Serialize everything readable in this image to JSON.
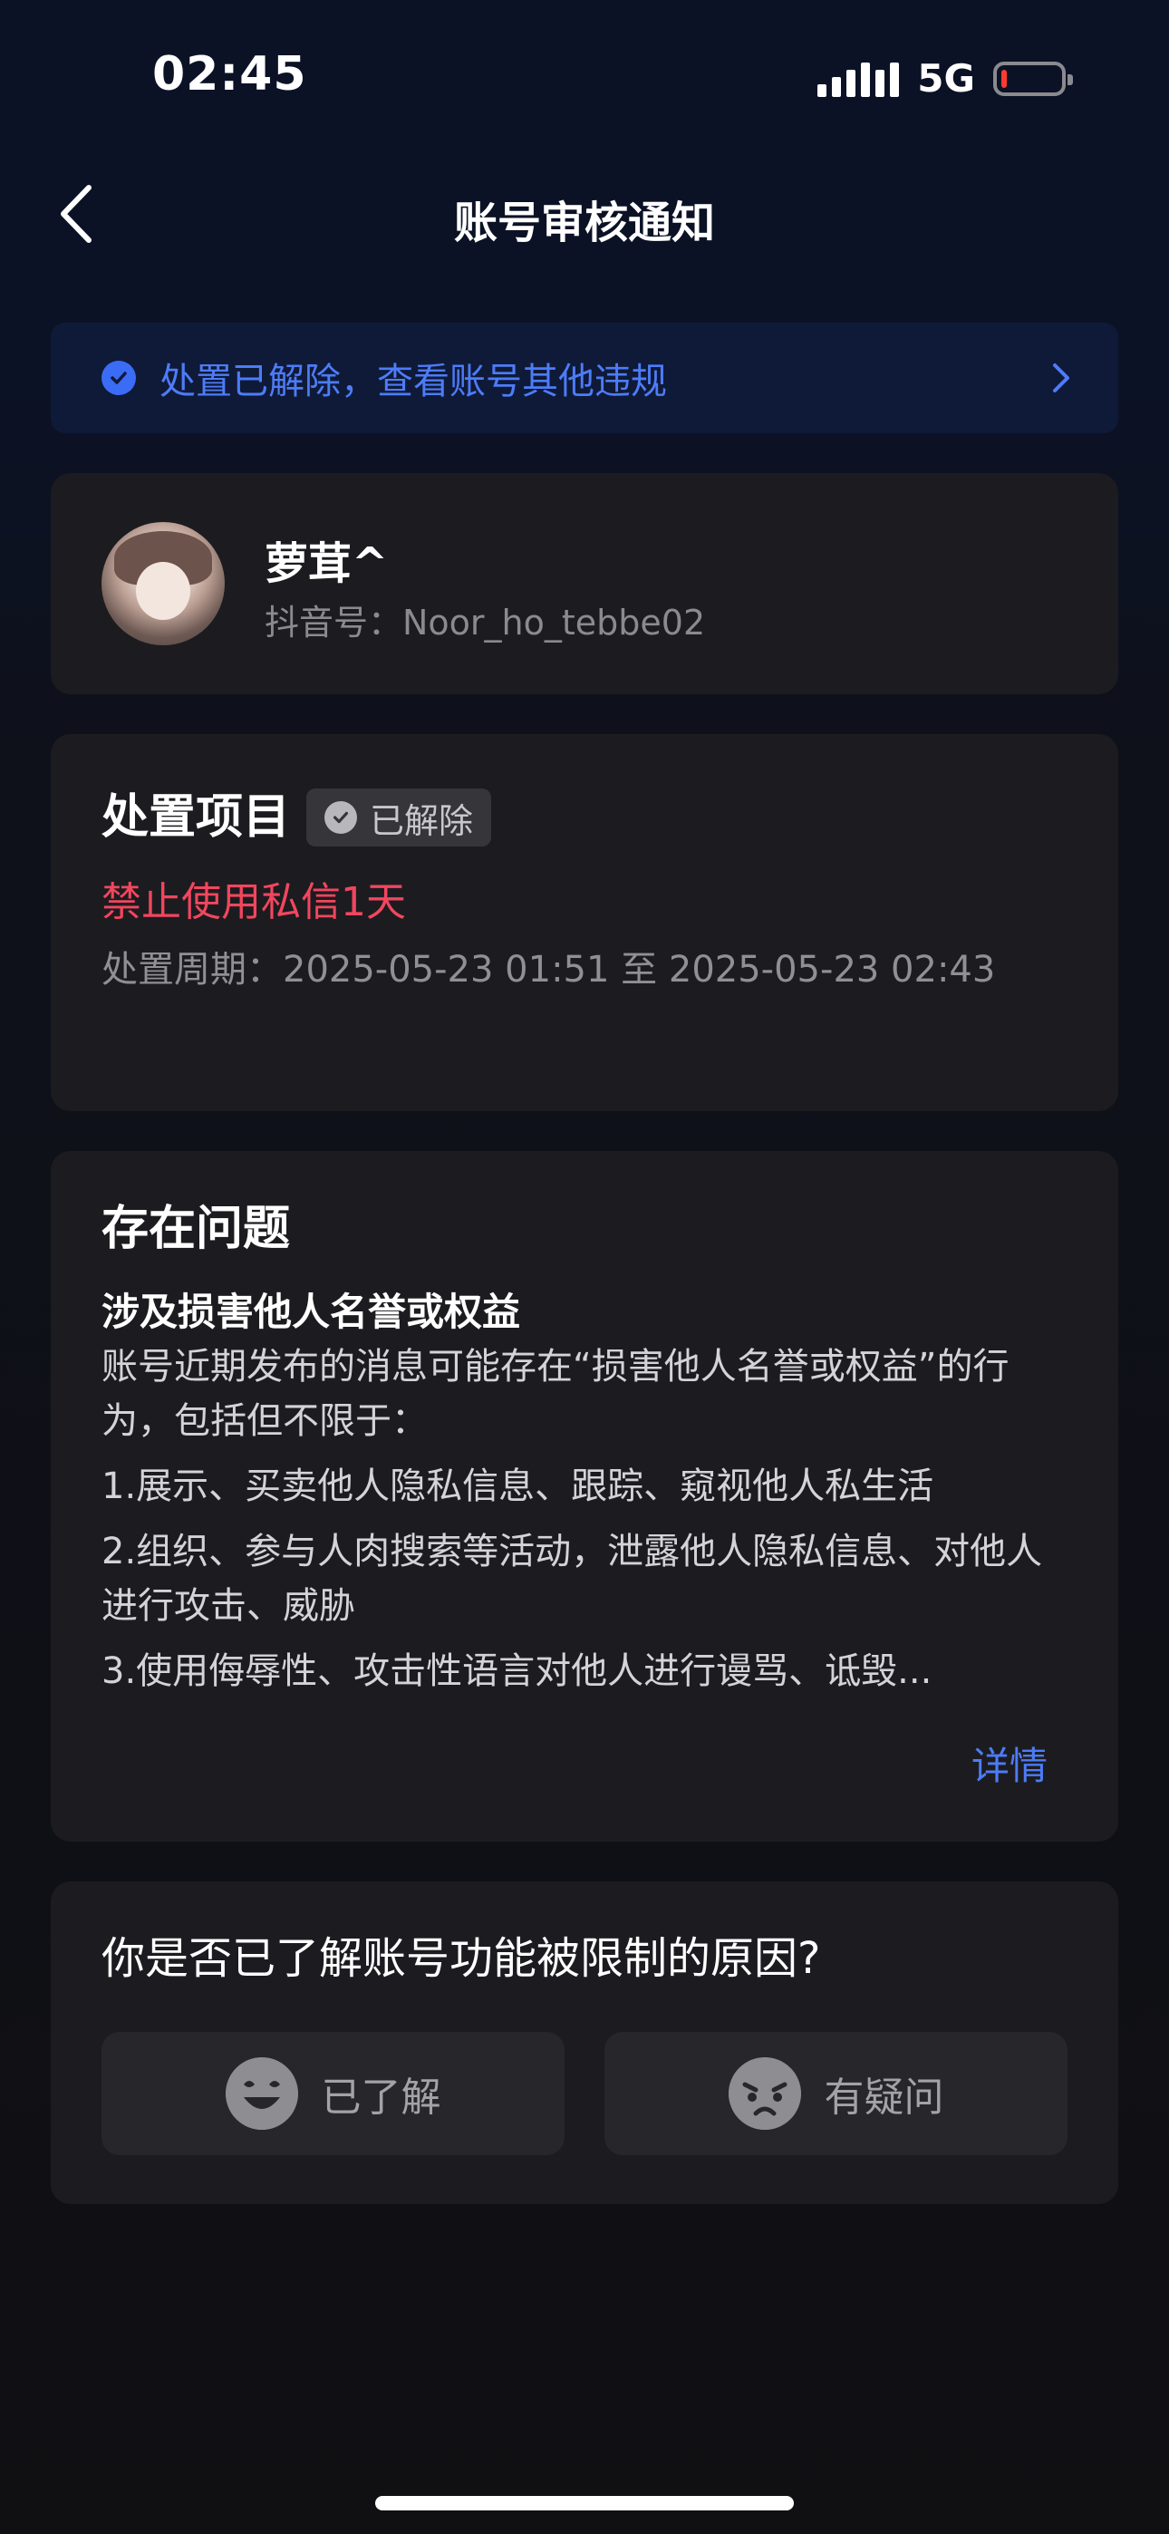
{
  "status_bar": {
    "time": "02:45",
    "network": "5G",
    "battery_level": 0.1,
    "battery_color": "#ff3b30"
  },
  "nav": {
    "title": "账号审核通知",
    "back_icon": "chevron-left-icon"
  },
  "banner": {
    "text": "处置已解除，查看账号其他违规",
    "icon": "check-circle-icon",
    "arrow_icon": "chevron-right-icon",
    "color": "#4d7cf8"
  },
  "user": {
    "name": "萝茸^",
    "id_line": "抖音号：Noor_ho_tebbe02"
  },
  "action": {
    "title": "处置项目",
    "badge": "已解除",
    "penalty": "禁止使用私信1天",
    "period": "处置周期：2025-05-23 01:51 至 2025-05-23 02:43",
    "penalty_color": "#f2465e"
  },
  "issue": {
    "title": "存在问题",
    "heading": "涉及损害他人名誉或权益",
    "description": "账号近期发布的消息可能存在“损害他人名誉或权益”的行为，包括但不限于：",
    "items": [
      "1.展示、买卖他人隐私信息、跟踪、窥视他人私生活",
      "2.组织、参与人肉搜索等活动，泄露他人隐私信息、对他人进行攻击、威胁",
      "3.使用侮辱性、攻击性语言对他人进行谩骂、诋毁..."
    ],
    "detail_link": "详情"
  },
  "question": {
    "text": "你是否已了解账号功能被限制的原因?",
    "options": [
      {
        "label": "已了解",
        "icon": "happy-face-icon"
      },
      {
        "label": "有疑问",
        "icon": "worried-face-icon"
      }
    ]
  }
}
